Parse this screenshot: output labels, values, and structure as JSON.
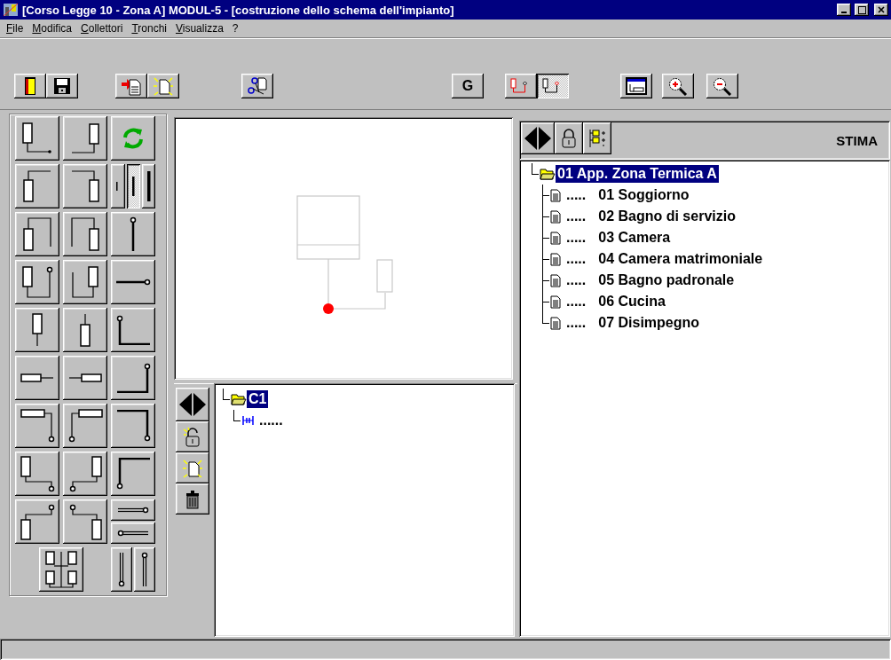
{
  "window": {
    "title": "[Corso Legge 10 - Zona A] MODUL-5 - [costruzione dello schema dell'impianto]"
  },
  "menu": [
    {
      "label": "File",
      "underlined": true
    },
    {
      "label": "Modifica",
      "underlined": true
    },
    {
      "label": "Collettori",
      "underlined": true
    },
    {
      "label": "Tronchi",
      "underlined": true
    },
    {
      "label": "Visualizza",
      "underlined": true
    },
    {
      "label": "?",
      "underlined": false
    }
  ],
  "toolbar": [
    {
      "items": [
        {
          "kind": "exit"
        },
        {
          "kind": "save"
        }
      ]
    },
    {
      "items": [
        {
          "kind": "import"
        },
        {
          "kind": "new"
        }
      ]
    },
    {
      "items": [
        {
          "kind": "cut"
        }
      ]
    },
    {
      "items": [
        {
          "kind": "text",
          "label": "G"
        }
      ]
    },
    {
      "items": [
        {
          "kind": "connect-red",
          "selected": false
        },
        {
          "kind": "connect-black",
          "selected": true
        }
      ]
    },
    {
      "items": [
        {
          "kind": "window"
        }
      ]
    },
    {
      "items": [
        {
          "kind": "zoom-in"
        }
      ]
    },
    {
      "items": [
        {
          "kind": "zoom-out"
        }
      ]
    }
  ],
  "palette": [
    {
      "kind": "riser-down-right"
    },
    {
      "kind": "riser-down-left"
    },
    {
      "kind": "refresh"
    },
    {
      "kind": "riser-up-right"
    },
    {
      "kind": "riser-up-left"
    },
    {
      "kind": "width-choice",
      "options": [
        {
          "selected": false
        },
        {
          "selected": true
        },
        {
          "selected": false
        }
      ]
    },
    {
      "kind": "loop-right"
    },
    {
      "kind": "loop-left"
    },
    {
      "kind": "valve-vertical"
    },
    {
      "kind": "loop-end-right"
    },
    {
      "kind": "loop-end-left"
    },
    {
      "kind": "valve-horizontal"
    },
    {
      "kind": "drop-down"
    },
    {
      "kind": "drop-up"
    },
    {
      "kind": "corner-bottom-left"
    },
    {
      "kind": "radiator-right"
    },
    {
      "kind": "radiator-left"
    },
    {
      "kind": "corner-bottom-right"
    },
    {
      "kind": "radiator-down-right"
    },
    {
      "kind": "radiator-down-left"
    },
    {
      "kind": "corner-top-right"
    },
    {
      "kind": "riser-step-right"
    },
    {
      "kind": "riser-step-left"
    },
    {
      "kind": "corner-top-left"
    },
    {
      "kind": "riser-rise-right"
    },
    {
      "kind": "riser-rise-left"
    },
    {
      "kind": "stack",
      "buttons": [
        {
          "kind": "end-right"
        },
        {
          "kind": "end-left"
        }
      ]
    },
    {
      "kind": "manifold"
    },
    {
      "kind": "pair",
      "buttons": [
        {
          "kind": "pipe-end-bottom"
        },
        {
          "kind": "pipe-end-top"
        }
      ]
    }
  ],
  "collector_panel": {
    "buttons": [
      {
        "kind": "arrows"
      },
      {
        "kind": "unlock"
      },
      {
        "kind": "new"
      },
      {
        "kind": "trash"
      }
    ],
    "tree": [
      {
        "label": "C1",
        "selected": true,
        "children": [
          {
            "leader": "......"
          }
        ]
      }
    ]
  },
  "estimate_panel": {
    "buttons": [
      {
        "kind": "arrows"
      },
      {
        "kind": "lock"
      },
      {
        "kind": "tree"
      }
    ],
    "title": "STIMA",
    "tree": [
      {
        "label": "01 App. Zona Termica A",
        "selected": true,
        "children": [
          {
            "leader": ".....",
            "label": "01 Soggiorno",
            "selected": false
          },
          {
            "leader": ".....",
            "label": "02 Bagno di servizio",
            "selected": false
          },
          {
            "leader": ".....",
            "label": "03 Camera",
            "selected": false
          },
          {
            "leader": ".....",
            "label": "04 Camera matrimoniale",
            "selected": false
          },
          {
            "leader": ".....",
            "label": "05 Bagno padronale",
            "selected": false
          },
          {
            "leader": ".....",
            "label": "06 Cucina",
            "selected": false
          },
          {
            "leader": ".....",
            "label": "07 Disimpegno",
            "selected": false
          }
        ]
      }
    ]
  }
}
